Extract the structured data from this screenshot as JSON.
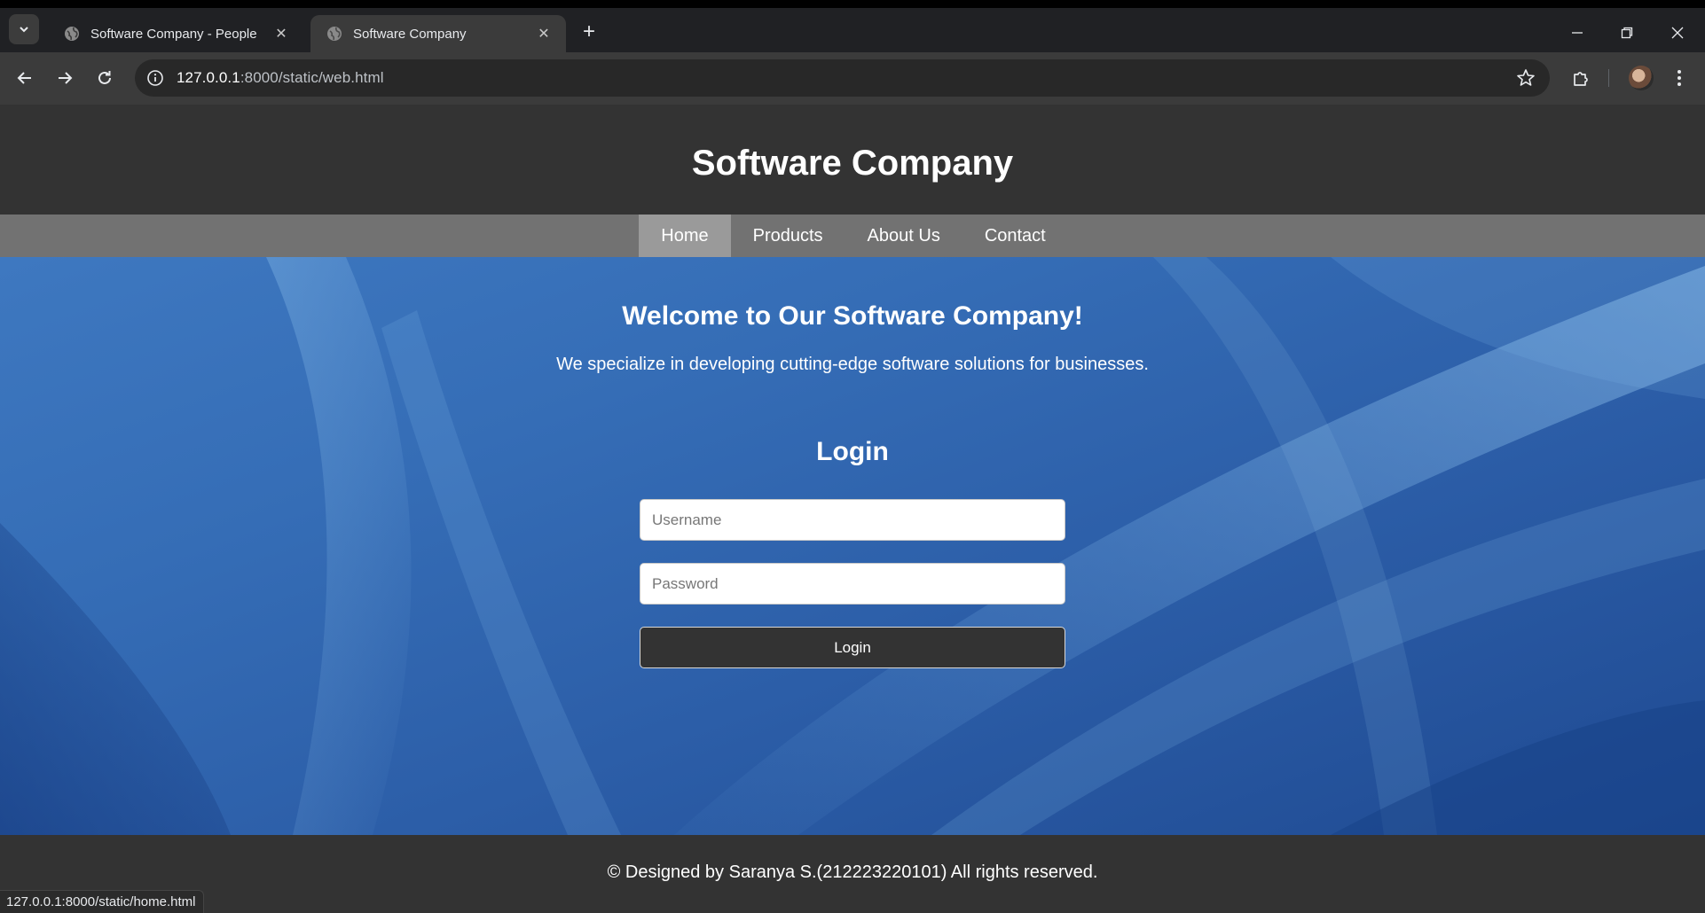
{
  "browser": {
    "tabs": [
      {
        "title": "Software Company - People",
        "active": false
      },
      {
        "title": "Software Company",
        "active": true
      }
    ],
    "url_host": "127.0.0.1",
    "url_rest": ":8000/static/web.html",
    "status_url": "127.0.0.1:8000/static/home.html"
  },
  "site": {
    "title": "Software Company",
    "nav": [
      "Home",
      "Products",
      "About Us",
      "Contact"
    ],
    "active_nav": "Home",
    "hero": {
      "heading": "Welcome to Our Software Company!",
      "tagline": "We specialize in developing cutting-edge software solutions for businesses."
    },
    "login": {
      "heading": "Login",
      "username_placeholder": "Username",
      "password_placeholder": "Password",
      "button_label": "Login"
    },
    "footer": "© Designed by Saranya S.(212223220101) All rights reserved."
  },
  "colors": {
    "header_bg": "#333333",
    "nav_bg": "#727272",
    "nav_active_bg": "#9a9a9a",
    "hero_blue": "#2c5ea8",
    "button_bg": "#333333"
  }
}
